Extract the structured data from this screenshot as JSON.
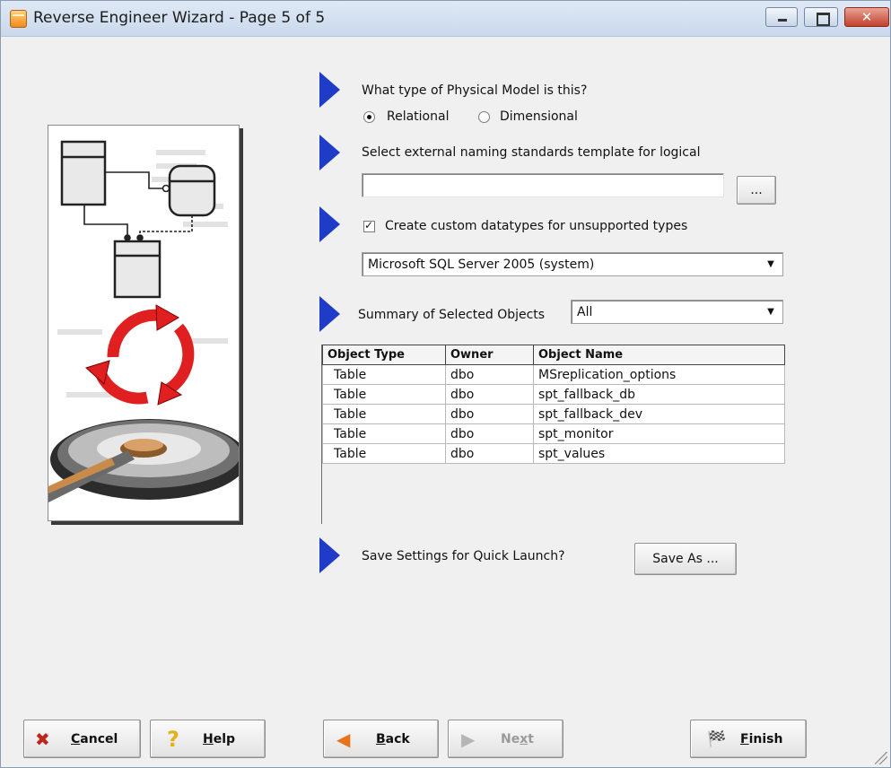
{
  "window": {
    "title": "Reverse Engineer Wizard - Page 5 of 5"
  },
  "model_type": {
    "question": "What type of Physical Model is this?",
    "options": [
      {
        "label": "Relational",
        "checked": true
      },
      {
        "label": "Dimensional",
        "checked": false
      }
    ]
  },
  "naming_standards": {
    "label": "Select external naming standards template for logical",
    "value": "",
    "browse_label": "..."
  },
  "custom_datatypes": {
    "label": "Create custom datatypes for unsupported types",
    "checked": true,
    "selected": "Microsoft SQL Server 2005 (system)"
  },
  "summary": {
    "label": "Summary of Selected Objects",
    "filter": "All",
    "columns": [
      "Object Type",
      "Owner",
      "Object Name"
    ],
    "rows": [
      [
        "Table",
        "dbo",
        "MSreplication_options"
      ],
      [
        "Table",
        "dbo",
        "spt_fallback_db"
      ],
      [
        "Table",
        "dbo",
        "spt_fallback_dev"
      ],
      [
        "Table",
        "dbo",
        "spt_monitor"
      ],
      [
        "Table",
        "dbo",
        "spt_values"
      ]
    ]
  },
  "quick_launch": {
    "label": "Save Settings for Quick Launch?",
    "save_as_label": "Save As ..."
  },
  "buttons": {
    "cancel": {
      "pre": "",
      "key": "C",
      "post": "ancel",
      "icon": "x-icon",
      "color": "#c0251b"
    },
    "help": {
      "pre": "",
      "key": "H",
      "post": "elp",
      "icon": "question-icon",
      "color": "#e3b21a"
    },
    "back": {
      "pre": "",
      "key": "B",
      "post": "ack",
      "icon": "arrow-left-icon",
      "color": "#e8731c"
    },
    "next": {
      "pre": "Ne",
      "key": "x",
      "post": "t",
      "icon": "arrow-right-icon",
      "disabled": true
    },
    "finish": {
      "pre": "",
      "key": "F",
      "post": "inish",
      "icon": "checkered-flag-icon"
    }
  },
  "colors": {
    "step_arrow": "#1f3cc9",
    "cycle_arrows": "#e02020"
  }
}
